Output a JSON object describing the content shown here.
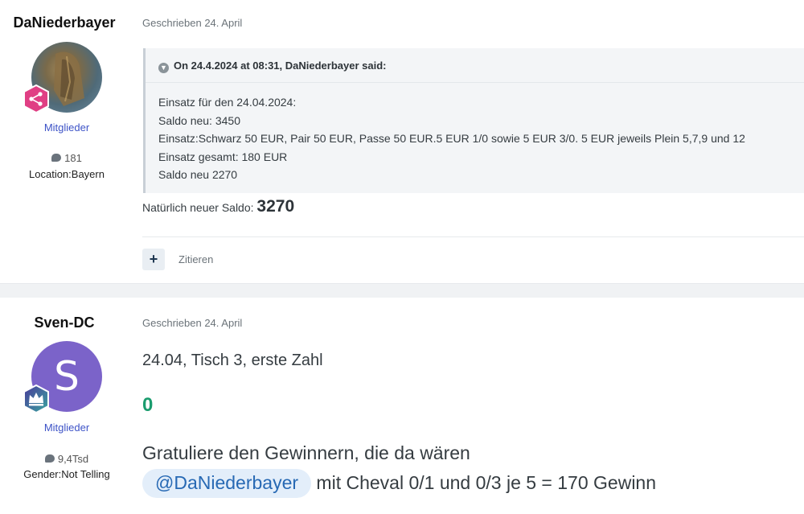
{
  "post1": {
    "author": "DaNiederbayer",
    "group": "Mitglieder",
    "post_count": "181",
    "location_label": "Location:",
    "location_value": "Bayern",
    "date": "Geschrieben 24. April",
    "quote": {
      "header": "On 24.4.2024 at 08:31, DaNiederbayer said:",
      "lines": [
        "Einsatz für den 24.04.2024:",
        "Saldo neu: 3450",
        "Einsatz:Schwarz 50 EUR, Pair 50 EUR, Passe 50 EUR.5 EUR 1/0 sowie 5 EUR 3/0. 5 EUR jeweils Plein 5,7,9 und 12",
        "Einsatz gesamt: 180 EUR",
        "Saldo neu 2270"
      ]
    },
    "saldo_text": "Natürlich neuer Saldo: ",
    "saldo_value": "3270",
    "plus_label": "+",
    "quote_action": "Zitieren"
  },
  "post2": {
    "author": "Sven-DC",
    "avatar_letter": "S",
    "group": "Mitglieder",
    "post_count": "9,4Tsd",
    "gender_label": "Gender:",
    "gender_value": "Not Telling",
    "date": "Geschrieben 24. April",
    "line1": "24.04, Tisch 3, erste Zahl",
    "number": "0",
    "line2": "Gratuliere den Gewinnern, die da wären",
    "mention": "@DaNiederbayer",
    "line3": " mit Cheval 0/1 und 0/3 je 5 = 170 Gewinn"
  },
  "colors": {
    "group_link": "#3d53c7",
    "number_green": "#1a9c6e",
    "mention_bg": "#e3eefa",
    "mention_text": "#2769b4",
    "avatar_purple": "#7b63c9",
    "badge_pink": "#e03f84",
    "badge_purple": "#6b4aa8"
  },
  "icons": [
    "comment-icon",
    "share-badge-icon",
    "crown-badge-icon",
    "chevron-down-icon",
    "plus-icon"
  ]
}
